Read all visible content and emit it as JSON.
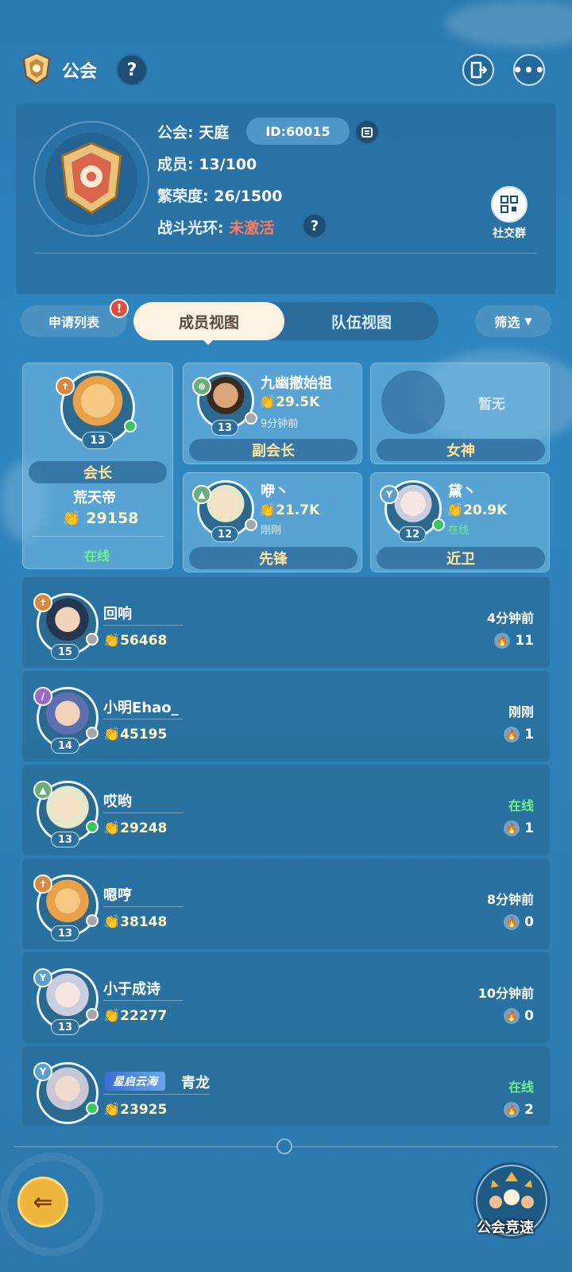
{
  "header": {
    "title": "公会",
    "help_icon": "question-icon",
    "exit_icon": "exit-door-icon",
    "more_icon": "more-dots-icon"
  },
  "guild": {
    "name_label": "公会:",
    "name": "天庭",
    "id": "ID:60015",
    "members_label": "成员:",
    "members": "13/100",
    "prosperity_label": "繁荣度:",
    "prosperity": "26/1500",
    "aura_label": "战斗光环:",
    "aura": "未激活",
    "social_label": "社交群"
  },
  "tabs": {
    "apply_list": "申请列表",
    "member_view": "成员视图",
    "team_view": "队伍视图",
    "filter": "筛选"
  },
  "roles": {
    "leader": {
      "level": "13",
      "role": "会长",
      "name": "荒天帝",
      "power": "29158",
      "status": "在线",
      "online": true
    },
    "vice": {
      "level": "13",
      "role": "副会长",
      "name": "九幽撤始祖",
      "power": "29.5K",
      "status": "9分钟前",
      "online": false
    },
    "goddess": {
      "role": "女神",
      "empty": "暂无"
    },
    "vanguard": {
      "level": "12",
      "role": "先锋",
      "name": "咿丶",
      "power": "21.7K",
      "status": "刚刚",
      "online": false
    },
    "guard": {
      "level": "12",
      "role": "近卫",
      "name": "黛丶",
      "power": "20.9K",
      "status": "在线",
      "online": true
    }
  },
  "members": [
    {
      "name": "回响",
      "level": "15",
      "power": "56468",
      "time": "4分钟前",
      "activity": "11",
      "online": false,
      "tag": ""
    },
    {
      "name": "小明Ehao_",
      "level": "14",
      "power": "45195",
      "time": "刚刚",
      "activity": "1",
      "online": false,
      "tag": ""
    },
    {
      "name": "哎哟",
      "level": "13",
      "power": "29248",
      "time": "在线",
      "activity": "1",
      "online": true,
      "tag": ""
    },
    {
      "name": "嗯哼",
      "level": "13",
      "power": "38148",
      "time": "8分钟前",
      "activity": "0",
      "online": false,
      "tag": ""
    },
    {
      "name": "小于成诗",
      "level": "13",
      "power": "22277",
      "time": "10分钟前",
      "activity": "0",
      "online": false,
      "tag": ""
    },
    {
      "name": "青龙",
      "level": "",
      "power": "23925",
      "time": "在线",
      "activity": "2",
      "online": true,
      "tag": "星启云海"
    }
  ],
  "bottom": {
    "race_label": "公会竞速"
  }
}
